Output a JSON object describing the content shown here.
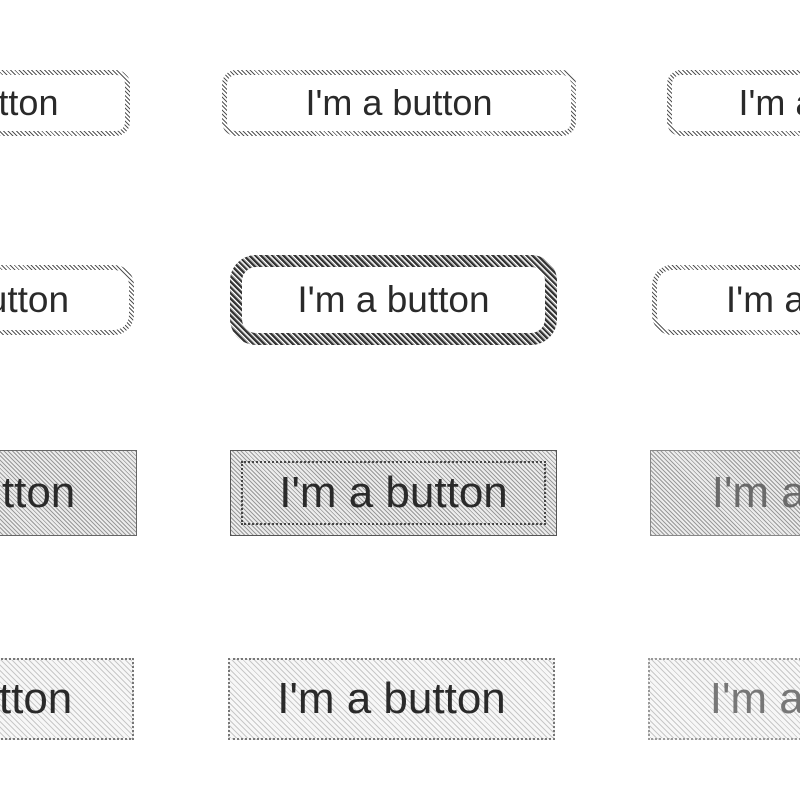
{
  "rows": [
    {
      "state": "default",
      "buttons": [
        {
          "label": "I'm a button"
        },
        {
          "label": "I'm a button"
        },
        {
          "label": "I'm a button"
        }
      ]
    },
    {
      "state": "focused",
      "buttons": [
        {
          "label": "I'm a button"
        },
        {
          "label": "I'm a button"
        },
        {
          "label": "I'm a button"
        }
      ]
    },
    {
      "state": "pressed",
      "buttons": [
        {
          "label": "I'm a button"
        },
        {
          "label": "I'm a button"
        },
        {
          "label": "I'm a button"
        }
      ]
    },
    {
      "state": "disabled",
      "buttons": [
        {
          "label": "I'm a button"
        },
        {
          "label": "I'm a button"
        },
        {
          "label": "I'm a button"
        }
      ]
    }
  ],
  "colors": {
    "background": "#ffffff",
    "text": "#2a2a2a",
    "border": "#555555",
    "fill_gray": "#d0d0d0"
  }
}
